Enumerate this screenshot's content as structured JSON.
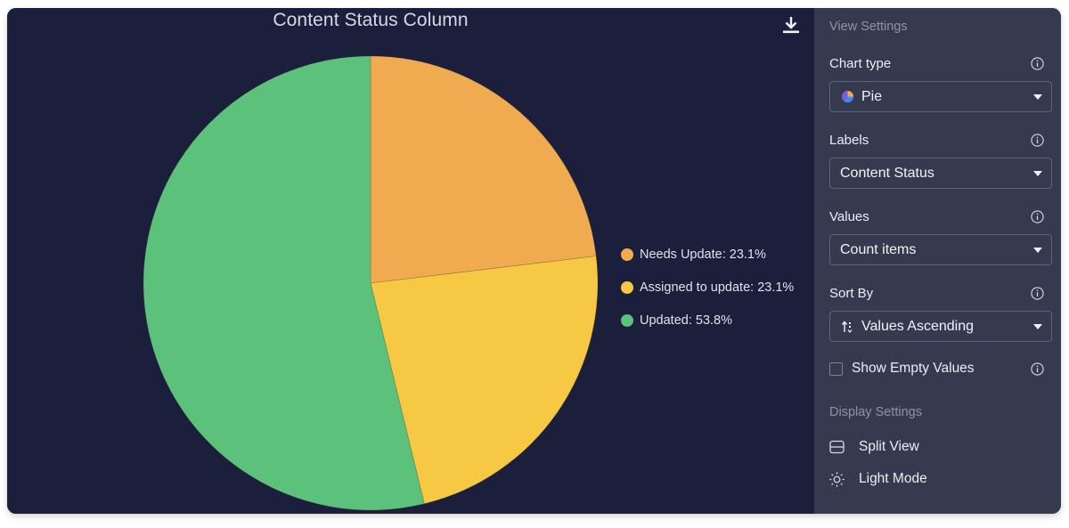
{
  "chart_data": {
    "type": "pie",
    "title": "Content Status Column",
    "start_angle_deg": 0,
    "direction": "clockwise",
    "slices": [
      {
        "label": "Needs Update",
        "percent": 23.1,
        "color": "#f0ab51"
      },
      {
        "label": "Assigned to update",
        "percent": 23.1,
        "color": "#f6c844"
      },
      {
        "label": "Updated",
        "percent": 53.8,
        "color": "#5cc27b"
      }
    ],
    "legend": {
      "placement": "right",
      "entries": [
        "Needs Update: 23.1%",
        "Assigned to update: 23.1%",
        "Updated: 53.8%"
      ]
    }
  },
  "toolbar": {
    "download_icon": "download-icon"
  },
  "panel": {
    "view_settings_title": "View Settings",
    "chart_type": {
      "label": "Chart type",
      "value": "Pie",
      "icon": "pie-chart-icon"
    },
    "labels": {
      "label": "Labels",
      "value": "Content Status"
    },
    "values": {
      "label": "Values",
      "value": "Count items"
    },
    "sort_by": {
      "label": "Sort By",
      "value": "Values Ascending",
      "icon": "sort-icon"
    },
    "show_empty": {
      "label": "Show Empty Values",
      "checked": false
    },
    "display_settings_title": "Display Settings",
    "display_items": [
      {
        "label": "Split View",
        "icon": "split-view-icon"
      },
      {
        "label": "Light Mode",
        "icon": "sun-icon"
      }
    ]
  },
  "colors": {
    "chart_background": "#1c1f3b",
    "panel_background": "#363a4f",
    "accent_orange": "#f0ab51",
    "accent_yellow": "#f6c844",
    "accent_green": "#5cc27b"
  }
}
